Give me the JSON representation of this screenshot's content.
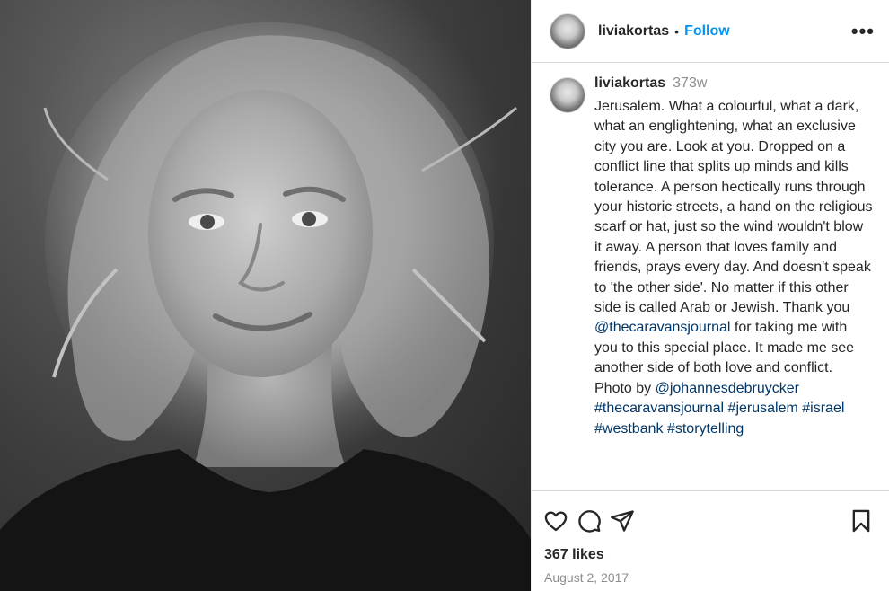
{
  "post": {
    "author": "liviakortas",
    "follow_label": "Follow",
    "separator": "•",
    "more_label": "•••",
    "caption": {
      "author": "liviakortas",
      "time": "373w",
      "text_1": "Jerusalem. What a colourful, what a dark, what an englightening, what an exclusive city you are. Look at you. Dropped on a conflict line that splits up minds and kills tolerance. A person hectically runs through your historic streets, a hand on the religious scarf or hat, just so the wind wouldn't blow it away. A person that loves family and friends, prays every day. And doesn't speak to 'the other side'. No matter if this other side is called Arab or Jewish. Thank you ",
      "mention_1": "@thecaravansjournal",
      "text_2": " for taking me with you to this special place. It made me see another side of both love and conflict. Photo by ",
      "mention_2": "@johannesdebruycker",
      "hashtags": [
        "#thecaravansjournal",
        "#jerusalem",
        "#israel",
        "#westbank",
        "#storytelling"
      ]
    },
    "likes": "367 likes",
    "date": "August 2, 2017",
    "icons": {
      "like": "heart-icon",
      "comment": "comment-icon",
      "share": "share-icon",
      "save": "bookmark-icon"
    }
  }
}
